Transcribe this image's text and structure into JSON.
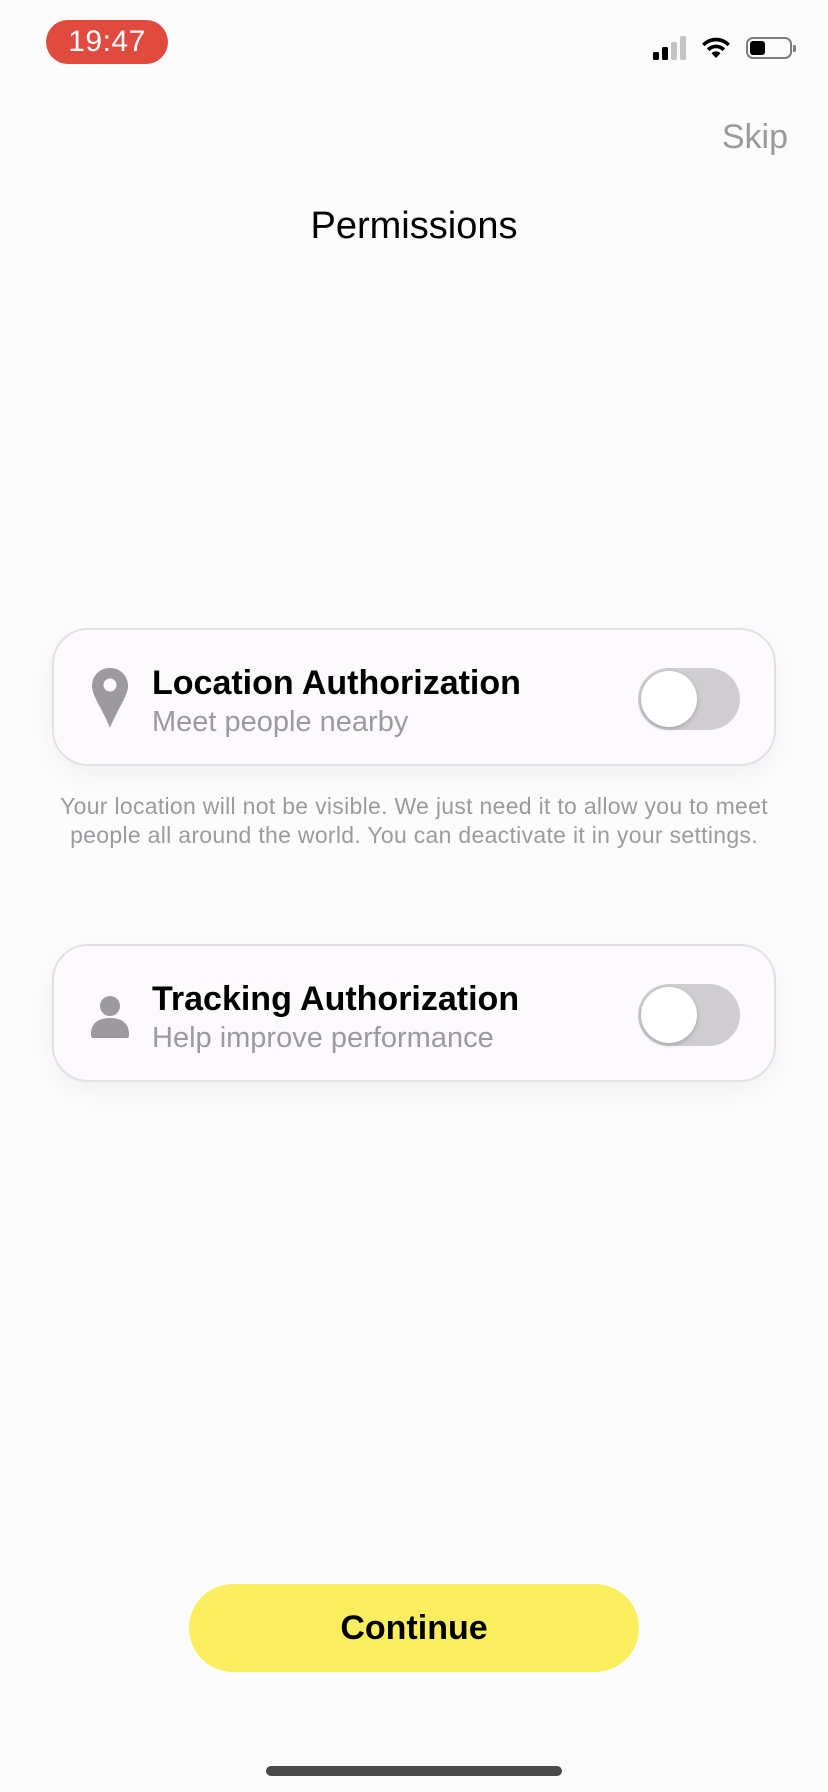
{
  "status_bar": {
    "time": "19:47",
    "time_pill_color": "#e14b3f",
    "icons": [
      "cellular-signal-icon",
      "wifi-icon",
      "battery-icon"
    ]
  },
  "header": {
    "skip_label": "Skip",
    "title": "Permissions"
  },
  "permissions": [
    {
      "icon": "location-pin-icon",
      "title": "Location Authorization",
      "subtitle": "Meet people nearby",
      "enabled": false
    },
    {
      "icon": "person-icon",
      "title": "Tracking Authorization",
      "subtitle": "Help improve performance",
      "enabled": false
    }
  ],
  "location_note": "Your location will not be visible. We just need it to allow you to meet people all around the world. You can deactivate it in your settings.",
  "footer": {
    "continue_label": "Continue",
    "continue_color": "#fbee5e"
  }
}
